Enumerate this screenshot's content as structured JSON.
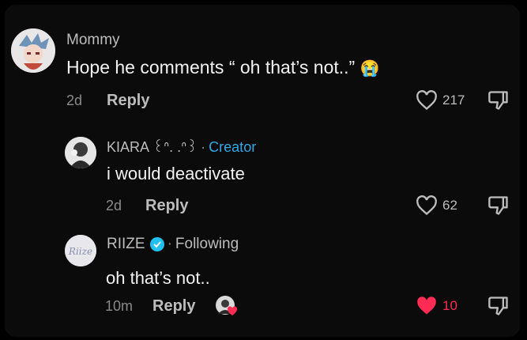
{
  "comments": [
    {
      "username": "Mommy",
      "text": "Hope he comments “ oh that’s not..” ",
      "emoji": "😭",
      "time": "2d",
      "reply_label": "Reply",
      "likes": "217",
      "liked": false
    },
    {
      "username": "KIARA ꒰ᐢ. .ᐢ꒱",
      "tag_separator": "·",
      "tag": "Creator",
      "text": "i would deactivate",
      "time": "2d",
      "reply_label": "Reply",
      "likes": "62",
      "liked": false
    },
    {
      "username": "RIIZE",
      "verified": true,
      "tag_separator": "·",
      "tag": "Following",
      "text": "oh that’s not..",
      "time": "10m",
      "reply_label": "Reply",
      "likes": "10",
      "liked": true
    }
  ],
  "avatars": {
    "riize_logo_text": "Riize"
  },
  "colors": {
    "liked": "#fe2c55",
    "creator": "#2fa8e8",
    "verified": "#20c0f0"
  }
}
